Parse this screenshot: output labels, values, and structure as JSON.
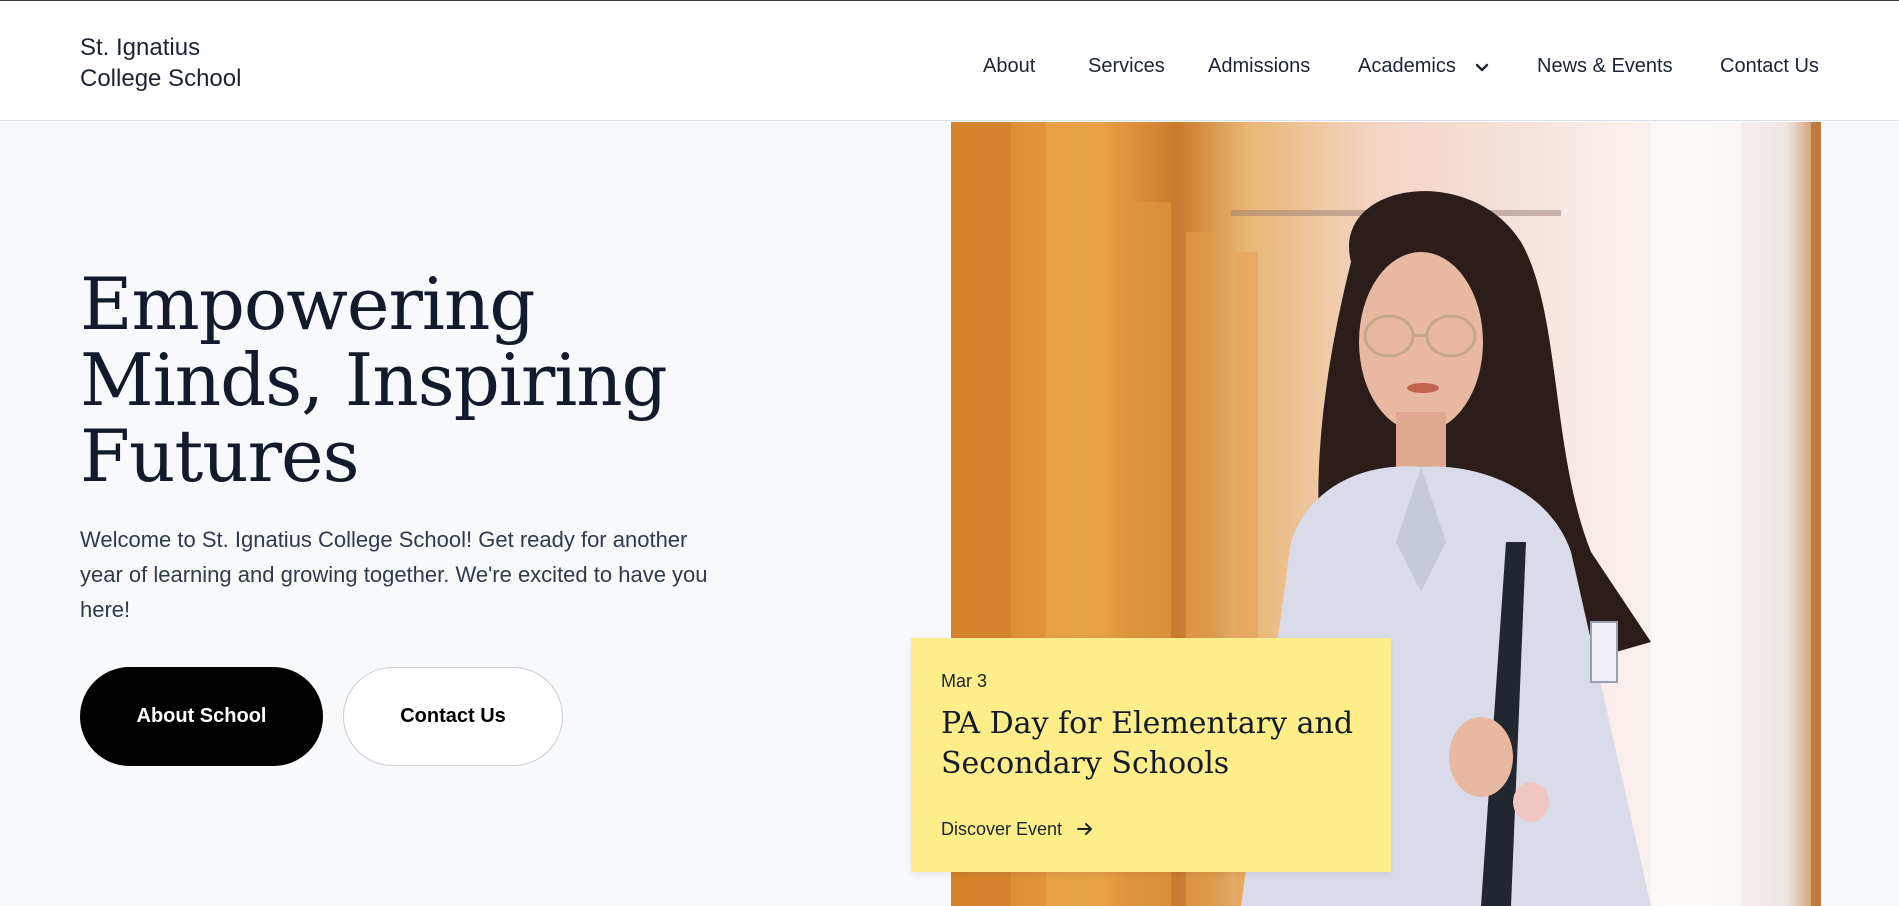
{
  "header": {
    "logo_line1": "St. Ignatius",
    "logo_line2": "College School",
    "nav": [
      {
        "label": "About"
      },
      {
        "label": "Services"
      },
      {
        "label": "Admissions"
      },
      {
        "label": "Academics",
        "icon": "chevron-down-icon"
      },
      {
        "label": "News & Events"
      },
      {
        "label": "Contact Us"
      }
    ]
  },
  "hero": {
    "title": "Empowering Minds, Inspiring Futures",
    "text": "Welcome to St. Ignatius College School! Get ready for another year of learning and growing together. We're excited to have you here!",
    "primary_button": "About School",
    "secondary_button": "Contact Us"
  },
  "event_card": {
    "date": "Mar 3",
    "title": "PA Day for Elementary and Secondary Schools",
    "link": "Discover Event",
    "link_icon": "arrow-right-icon",
    "background": "#fdee8a"
  },
  "colors": {
    "page_background": "#f8f9fb",
    "primary_button": "#000000",
    "text": "#121a2b"
  }
}
